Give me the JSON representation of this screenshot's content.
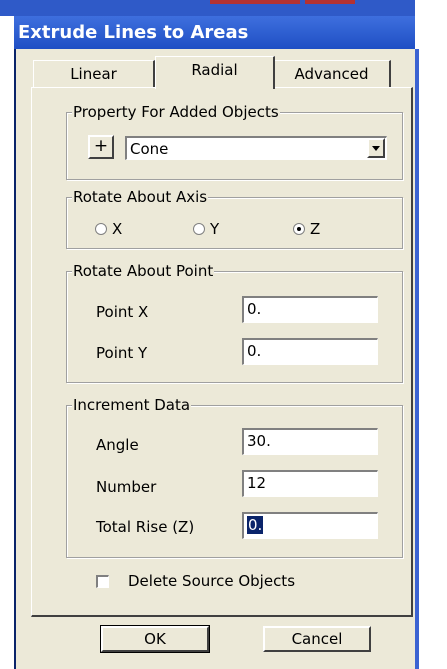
{
  "window": {
    "title": "Extrude Lines to Areas"
  },
  "tabs": [
    {
      "label": "Linear",
      "active": false
    },
    {
      "label": "Radial",
      "active": true
    },
    {
      "label": "Advanced",
      "active": false
    }
  ],
  "property_group": {
    "legend": "Property For Added Objects",
    "add_label": "+",
    "selected": "Cone"
  },
  "axis_group": {
    "legend": "Rotate About Axis",
    "options": [
      "X",
      "Y",
      "Z"
    ],
    "selected": "Z"
  },
  "point_group": {
    "legend": "Rotate About Point",
    "point_x_label": "Point X",
    "point_x_value": "0.",
    "point_y_label": "Point Y",
    "point_y_value": "0."
  },
  "increment_group": {
    "legend": "Increment Data",
    "angle_label": "Angle",
    "angle_value": "30.",
    "number_label": "Number",
    "number_value": "12",
    "rise_label": "Total Rise (Z)",
    "rise_value": "0."
  },
  "delete_source": {
    "label": "Delete Source Objects",
    "checked": false
  },
  "buttons": {
    "ok": "OK",
    "cancel": "Cancel"
  },
  "colors": {
    "titlebar": "#2a5bd7",
    "dialog_bg": "#ece9d8",
    "selection": "#0a246a"
  }
}
